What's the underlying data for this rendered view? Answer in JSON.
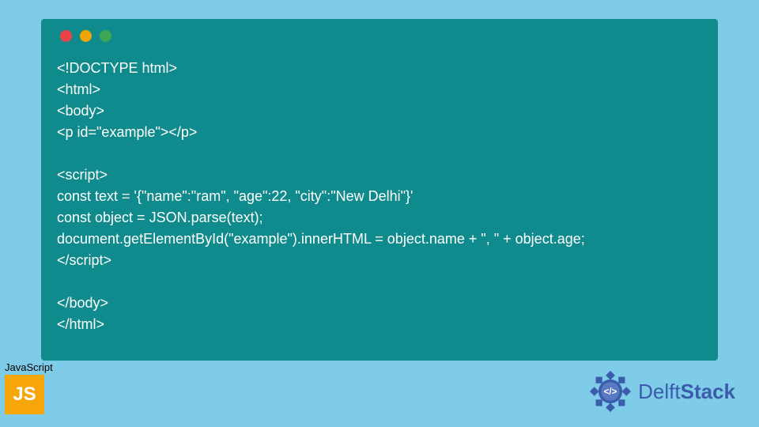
{
  "code": {
    "lines": [
      "<!DOCTYPE html>",
      "<html>",
      "<body>",
      "<p id=\"example\"></p>",
      "",
      "<script>",
      "const text = '{\"name\":\"ram\", \"age\":22, \"city\":\"New Delhi\"}'",
      "const object = JSON.parse(text);",
      "document.getElementById(\"example\").innerHTML = object.name + \", \" + object.age;",
      "</script>",
      "",
      "</body>",
      "</html>"
    ]
  },
  "badge": {
    "language_label": "JavaScript",
    "icon_text": "JS"
  },
  "brand": {
    "name_part1": "Delft",
    "name_part2": "Stack"
  },
  "colors": {
    "window_bg": "#0f8b8d",
    "page_bg": "#7ecce8",
    "js_orange": "#f7a60a",
    "brand_blue": "#3a5caa"
  }
}
